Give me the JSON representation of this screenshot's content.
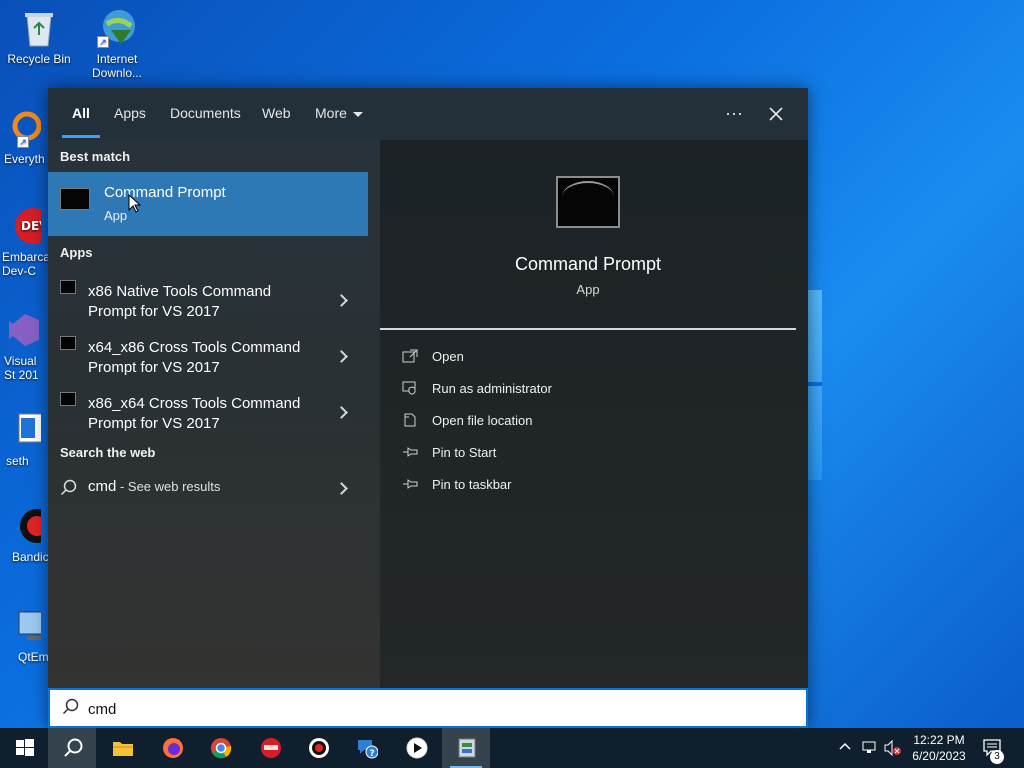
{
  "desktop": {
    "icons": [
      {
        "id": "recycle-bin",
        "label": "Recycle Bin"
      },
      {
        "id": "idm",
        "label": "Internet Downlo..."
      },
      {
        "id": "everything",
        "label": "Everyth"
      },
      {
        "id": "devcpp",
        "label": "Embarca Dev-C"
      },
      {
        "id": "visual-studio",
        "label": "Visual St 201"
      },
      {
        "id": "seth",
        "label": "seth"
      },
      {
        "id": "bandicam",
        "label": "Bandic"
      },
      {
        "id": "qtem",
        "label": "QtEm"
      }
    ]
  },
  "search_panel": {
    "tabs": [
      {
        "label": "All",
        "active": true
      },
      {
        "label": "Apps"
      },
      {
        "label": "Documents"
      },
      {
        "label": "Web"
      },
      {
        "label": "More"
      }
    ],
    "more_options_icon": "ellipsis-icon",
    "close_icon": "close-icon",
    "best_match_label": "Best match",
    "best_match": {
      "title": "Command Prompt",
      "subtitle": "App"
    },
    "apps_label": "Apps",
    "apps": [
      {
        "label": "x86 Native Tools Command Prompt for VS 2017"
      },
      {
        "label": "x64_x86 Cross Tools Command Prompt for VS 2017"
      },
      {
        "label": "x86_x64 Cross Tools Command Prompt for VS 2017"
      }
    ],
    "web_label": "Search the web",
    "web_result": {
      "query": "cmd",
      "suffix": " - See web results"
    },
    "detail": {
      "title": "Command Prompt",
      "subtitle": "App",
      "actions": [
        {
          "label": "Open",
          "icon": "open-icon"
        },
        {
          "label": "Run as administrator",
          "icon": "shield-icon"
        },
        {
          "label": "Open file location",
          "icon": "folder-icon"
        },
        {
          "label": "Pin to Start",
          "icon": "pin-icon"
        },
        {
          "label": "Pin to taskbar",
          "icon": "pin-icon"
        }
      ]
    },
    "search_value": "cmd"
  },
  "taskbar": {
    "apps": [
      "start-icon",
      "search-icon",
      "file-explorer-icon",
      "firefox-icon",
      "chrome-icon",
      "devcpp-icon",
      "record-icon",
      "help-icon",
      "media-player-icon",
      "network-tool-icon"
    ],
    "clock_time": "12:22 PM",
    "clock_date": "6/20/2023",
    "notification_count": "3"
  },
  "colors": {
    "accent": "#2e78b5",
    "taskbar": "#0f1f2e",
    "search_border": "#0a73e0"
  }
}
